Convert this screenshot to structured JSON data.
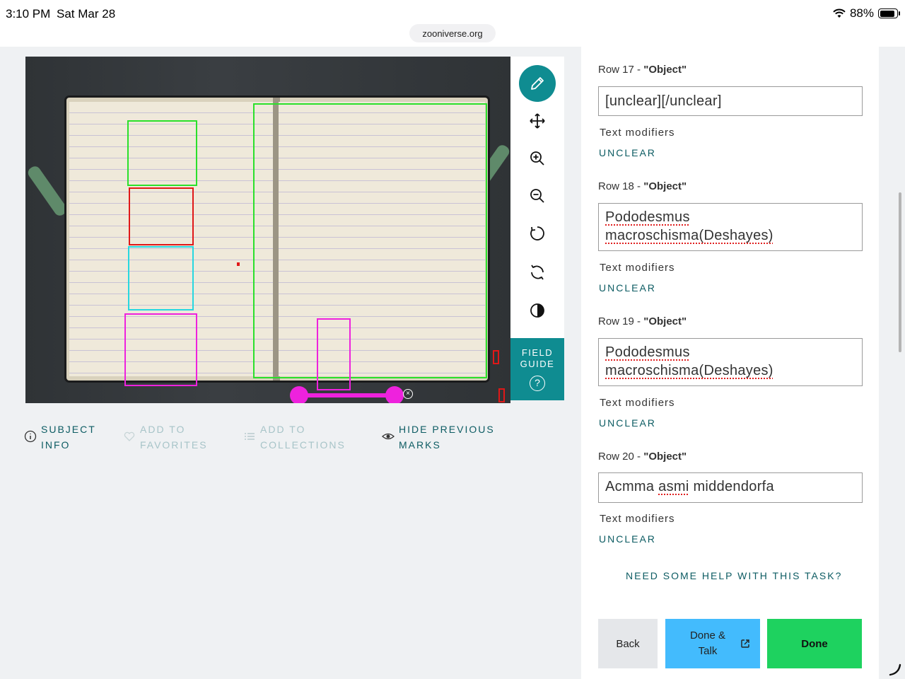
{
  "status_bar": {
    "time": "3:10 PM",
    "date": "Sat Mar 28",
    "battery": "88%",
    "battery_level": 0.88
  },
  "browser": {
    "url": "zooniverse.org"
  },
  "toolbar": {
    "tools": [
      {
        "name": "pencil-icon",
        "active": true
      },
      {
        "name": "move-icon",
        "active": false
      },
      {
        "name": "zoom-in-icon",
        "active": false
      },
      {
        "name": "zoom-out-icon",
        "active": false
      },
      {
        "name": "rotate-icon",
        "active": false
      },
      {
        "name": "reset-icon",
        "active": false
      },
      {
        "name": "invert-icon",
        "active": false
      }
    ],
    "field_guide_line1": "FIELD",
    "field_guide_line2": "GUIDE",
    "field_guide_icon": "?"
  },
  "meta": {
    "subject_info_1": "SUBJECT",
    "subject_info_2": "INFO",
    "favorites_1": "ADD TO",
    "favorites_2": "FAVORITES",
    "collections_1": "ADD TO",
    "collections_2": "COLLECTIONS",
    "hide_marks_1": "HIDE PREVIOUS",
    "hide_marks_2": "MARKS"
  },
  "task": {
    "rows": [
      {
        "label": "Row 17 - ",
        "field": "\"Object\"",
        "value": "[unclear][/unclear]",
        "modifiers_label": "Text modifiers",
        "modifier": "UNCLEAR"
      },
      {
        "label": "Row 18 - ",
        "field": "\"Object\"",
        "value_line1": "Pododesmus",
        "value_line2": "macroschisma(Deshayes)",
        "modifiers_label": "Text modifiers",
        "modifier": "UNCLEAR"
      },
      {
        "label": "Row 19 - ",
        "field": "\"Object\"",
        "value_line1": "Pododesmus",
        "value_line2": "macroschisma(Deshayes)",
        "modifiers_label": "Text modifiers",
        "modifier": "UNCLEAR"
      },
      {
        "label": "Row 20 - ",
        "field": "\"Object\"",
        "value_word1": "Acmma",
        "value_word2": "asmi",
        "value_word3": "middendorfa",
        "modifiers_label": "Text modifiers",
        "modifier": "UNCLEAR"
      }
    ],
    "help": "NEED SOME HELP WITH THIS TASK?",
    "back": "Back",
    "done_talk_1": "Done &",
    "done_talk_2": "Talk",
    "done": "Done"
  },
  "colors": {
    "teal": "#0f8c91",
    "dark_teal": "#0d5c63",
    "talk_blue": "#43bbfd",
    "done_green": "#1ed25f",
    "mark_green": "#2be02b",
    "mark_red": "#e01818",
    "mark_cyan": "#27d7e0",
    "mark_magenta": "#ee22dd"
  }
}
